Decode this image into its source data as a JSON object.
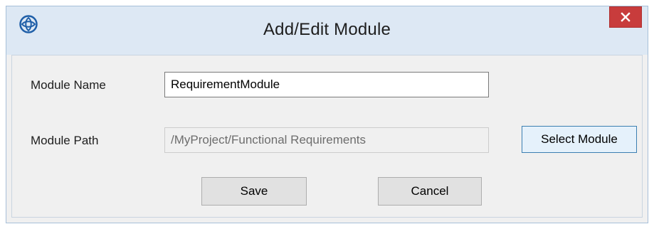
{
  "window": {
    "title": "Add/Edit Module",
    "app_icon": "app-logo-icon",
    "close_icon": "close-icon"
  },
  "form": {
    "module_name_label": "Module Name",
    "module_name_value": "RequirementModule",
    "module_path_label": "Module Path",
    "module_path_value": "/MyProject/Functional Requirements",
    "select_module_label": "Select Module"
  },
  "actions": {
    "save_label": "Save",
    "cancel_label": "Cancel"
  },
  "colors": {
    "titlebar": "#dde8f4",
    "close_button": "#c83c3c",
    "app_icon": "#1f5fa8",
    "dialog_background": "#f0f0f0"
  }
}
